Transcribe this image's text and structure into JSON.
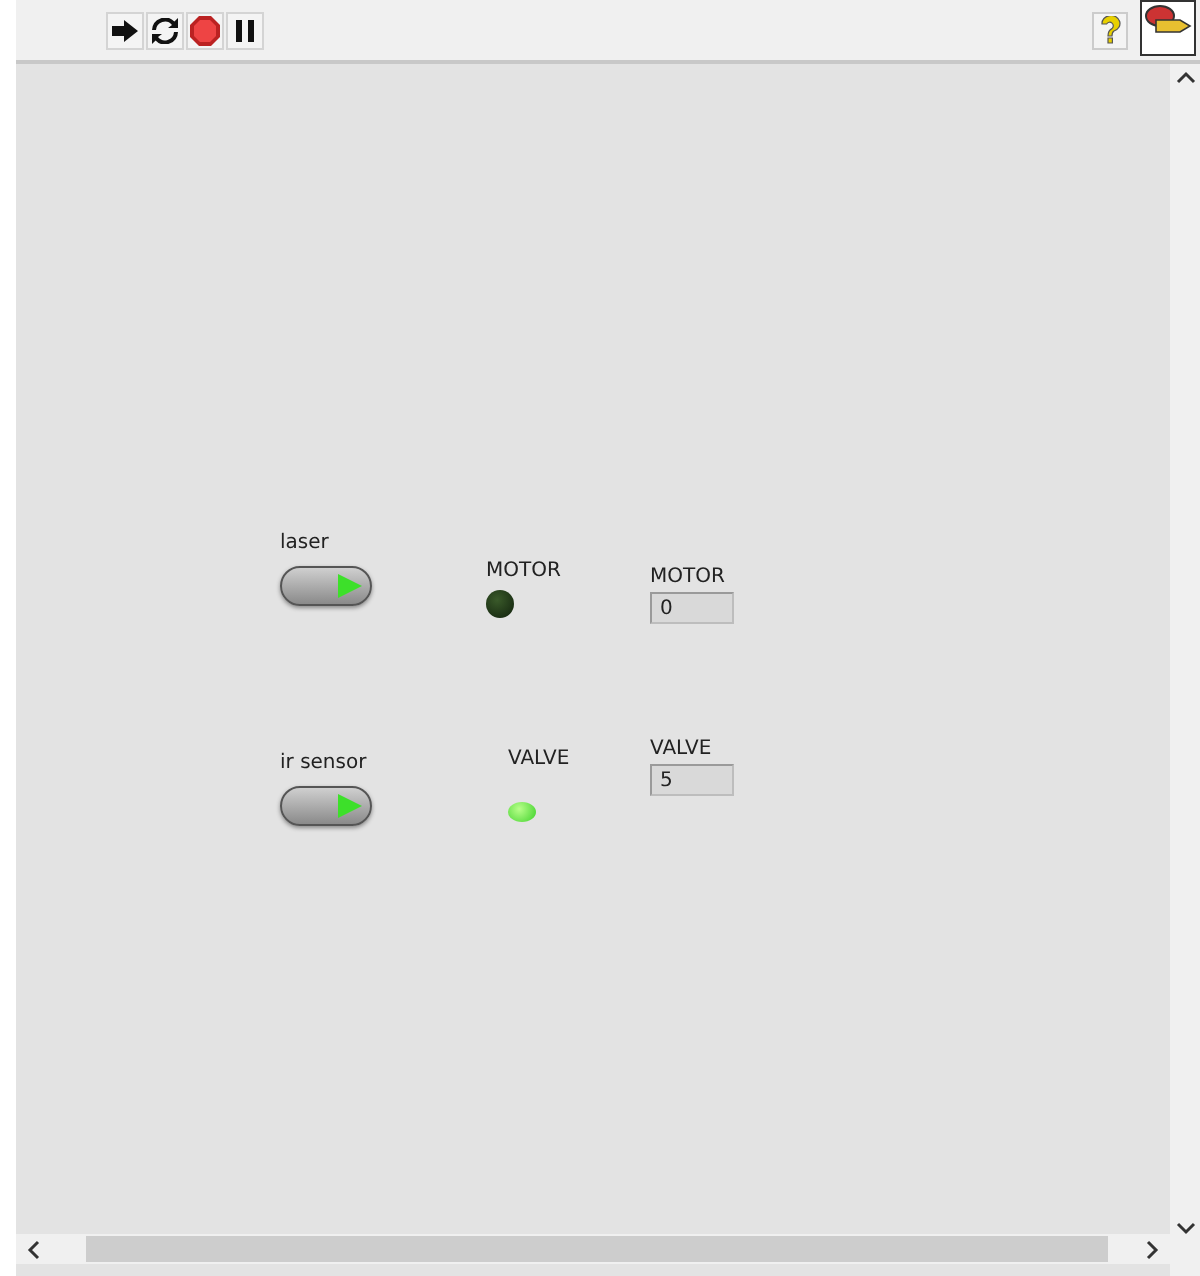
{
  "toolbar": {
    "buttons": [
      {
        "kind": "run"
      },
      {
        "kind": "run_continuously"
      },
      {
        "kind": "abort"
      },
      {
        "kind": "pause"
      }
    ],
    "help": {
      "kind": "help"
    }
  },
  "controls": [
    {
      "kind": "switch",
      "label": "laser",
      "on": true
    },
    {
      "kind": "led",
      "label": "MOTOR",
      "on": false
    },
    {
      "kind": "numeric",
      "label": "MOTOR",
      "value": "0"
    },
    {
      "kind": "switch",
      "label": "ir sensor",
      "on": true
    },
    {
      "kind": "led",
      "label": "VALVE",
      "on": true
    },
    {
      "kind": "numeric",
      "label": "VALVE",
      "value": "5"
    }
  ]
}
